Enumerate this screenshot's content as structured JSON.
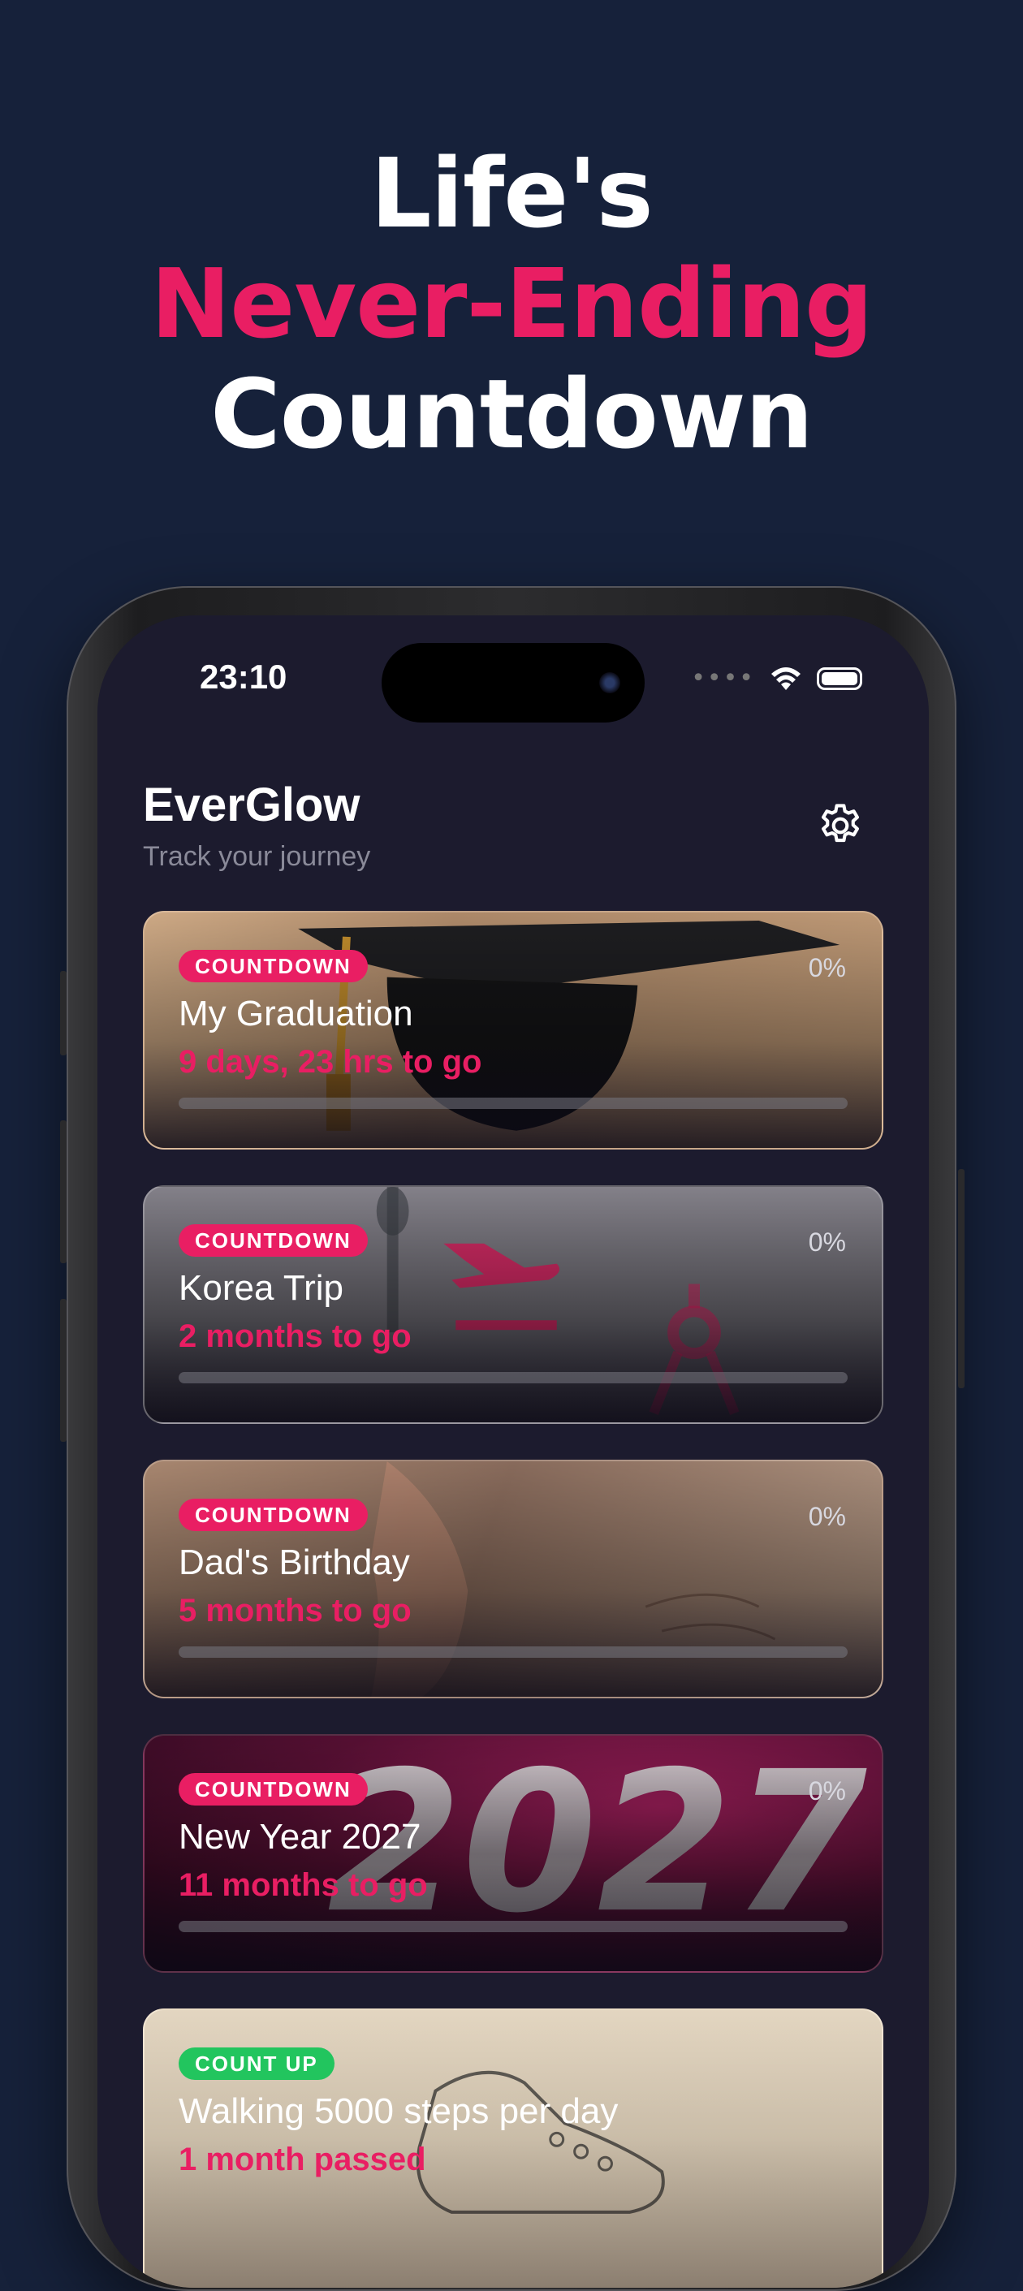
{
  "headline": {
    "line1": "Life's",
    "line2": "Never-Ending",
    "line3": "Countdown"
  },
  "status_bar": {
    "time": "23:10",
    "icons": [
      "wifi-icon",
      "battery-icon"
    ]
  },
  "app": {
    "title": "EverGlow",
    "subtitle": "Track your journey",
    "settings_icon": "gear-icon"
  },
  "cards": [
    {
      "badge": "COUNTDOWN",
      "badge_color": "#e91e63",
      "title": "My Graduation",
      "subtitle": "9 days, 23 hrs to go",
      "percent": "0%",
      "progress": 0
    },
    {
      "badge": "COUNTDOWN",
      "badge_color": "#e91e63",
      "title": "Korea Trip",
      "subtitle": "2 months to go",
      "percent": "0%",
      "progress": 0
    },
    {
      "badge": "COUNTDOWN",
      "badge_color": "#e91e63",
      "title": "Dad's Birthday",
      "subtitle": "5 months to go",
      "percent": "0%",
      "progress": 0
    },
    {
      "badge": "COUNTDOWN",
      "badge_color": "#e91e63",
      "title": "New Year 2027",
      "subtitle": "11 months to go",
      "percent": "0%",
      "progress": 0,
      "art_text": "2027"
    },
    {
      "badge": "COUNT UP",
      "badge_color": "#22c55e",
      "title": "Walking 5000 steps per day",
      "subtitle": "1 month passed"
    }
  ],
  "colors": {
    "background": "#16213a",
    "accent": "#e91e63",
    "count_up": "#22c55e",
    "screen": "#1c1b2e"
  }
}
